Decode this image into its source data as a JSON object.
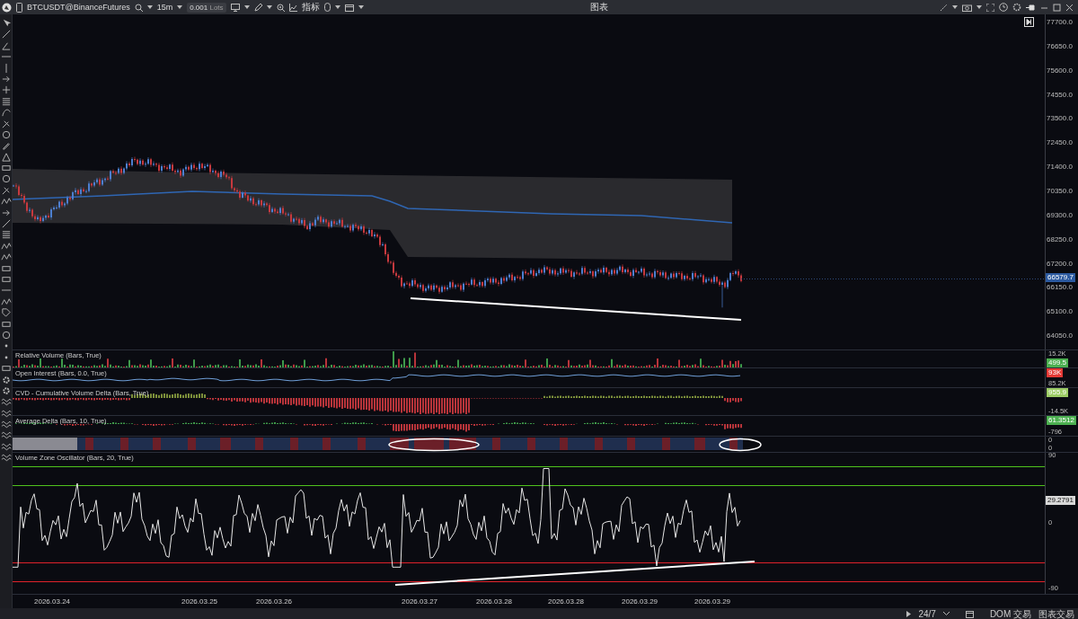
{
  "window": {
    "title": "图表"
  },
  "toolbar": {
    "symbol": "BTCUSDT@BinanceFutures",
    "interval": "15m",
    "quantity": "0.001",
    "quantity_unit": "Lots",
    "indicators": "指标"
  },
  "price_axis": {
    "ticks": [
      "77700.0",
      "76650.0",
      "75600.0",
      "74550.0",
      "73500.0",
      "72450.0",
      "71400.0",
      "70350.0",
      "69300.0",
      "68250.0",
      "67200.0",
      "66150.0",
      "65100.0",
      "64050.0"
    ],
    "last_price": "66579.7"
  },
  "panes": [
    {
      "kind": "relative_volume",
      "title": "Relative Volume (Bars, True)",
      "axis_labels": [
        "15.2K"
      ],
      "value": "499.5",
      "color": "#4caf50"
    },
    {
      "kind": "open_interest",
      "title": "Open Interest (Bars, 0.0, True)",
      "axis_labels": [
        "85.2K"
      ],
      "value": "93K",
      "color": "#e53935"
    },
    {
      "kind": "cvd",
      "title": "CVD - Cumulative Volume Delta (Bars, True)",
      "axis_labels": [
        "-14.5K"
      ],
      "value": "955.9",
      "color": "#9ccc65"
    },
    {
      "kind": "average_delta",
      "title": "Average Delta (Bars, 10, True)",
      "axis_labels": [
        "-796"
      ],
      "value": "61.3512",
      "color": "#4caf50"
    },
    {
      "kind": "heat_strip",
      "axis_labels": [
        "0",
        "0"
      ]
    }
  ],
  "oscillator": {
    "title": "Volume Zone Oscillator (Bars, 20, True)",
    "ticks": [
      "90",
      "0",
      "-90"
    ],
    "value": "29.2791"
  },
  "date_axis": [
    "2026.03.24",
    "2026.03.25",
    "2026.03.26",
    "2026.03.27",
    "2026.03.28",
    "2026.03.28",
    "2026.03.29",
    "2026.03.29"
  ],
  "status_bar": {
    "session": "24/7",
    "dom_trading": "DOM 交易",
    "chart_trading": "图表交易"
  }
}
